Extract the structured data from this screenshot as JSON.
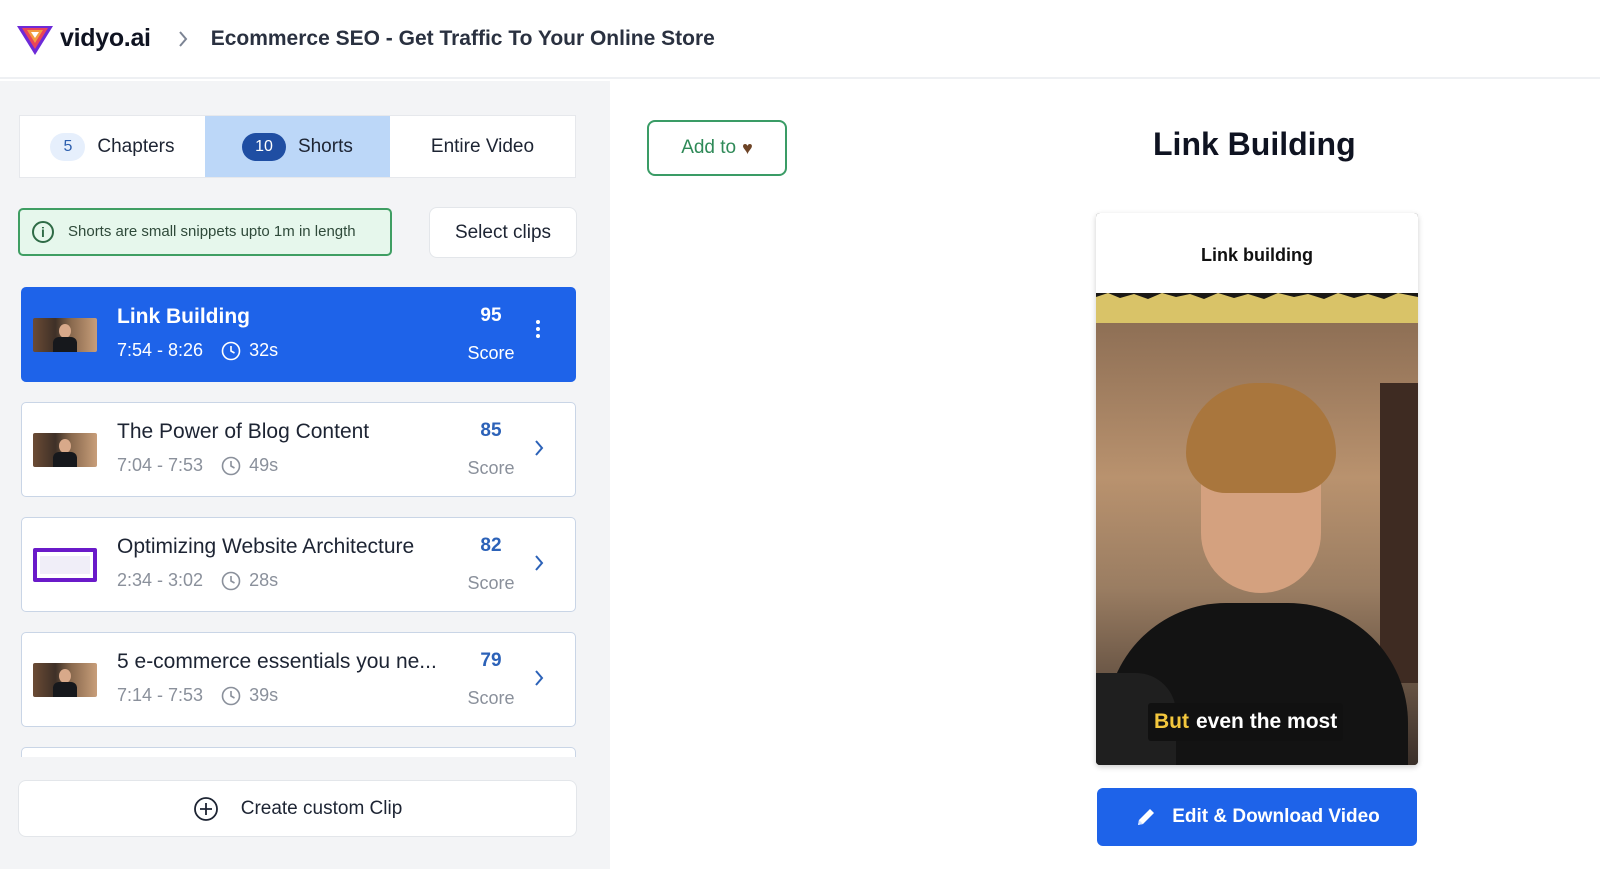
{
  "header": {
    "brand": "vidyo.ai",
    "breadcrumb_title": "Ecommerce SEO - Get Traffic To Your Online Store"
  },
  "tabs": [
    {
      "count": "5",
      "label": "Chapters",
      "active": false
    },
    {
      "count": "10",
      "label": "Shorts",
      "active": true
    },
    {
      "count": "",
      "label": "Entire Video",
      "active": false
    }
  ],
  "info": {
    "text": "Shorts are small snippets upto 1m in length"
  },
  "select_clips_label": "Select clips",
  "clips": [
    {
      "title": "Link Building",
      "range": "7:54 - 8:26",
      "duration": "32s",
      "score": "95",
      "score_label": "Score",
      "active": true
    },
    {
      "title": "The Power of Blog Content",
      "range": "7:04 - 7:53",
      "duration": "49s",
      "score": "85",
      "score_label": "Score",
      "active": false
    },
    {
      "title": "Optimizing Website Architecture",
      "range": "2:34 - 3:02",
      "duration": "28s",
      "score": "82",
      "score_label": "Score",
      "active": false
    },
    {
      "title": "5 e-commerce essentials you ne...",
      "range": "7:14 - 7:53",
      "duration": "39s",
      "score": "79",
      "score_label": "Score",
      "active": false
    }
  ],
  "create_custom_clip_label": "Create custom Clip",
  "preview": {
    "add_to_label": "Add to",
    "title": "Link Building",
    "video_title": "Link building",
    "caption_highlight": "But",
    "caption_rest": "even the most",
    "edit_download_label": "Edit & Download Video"
  },
  "colors": {
    "accent": "#1e63e9",
    "active_tab": "#bcd7f8",
    "info_bg": "#e6f7ec",
    "success": "#3a9c66"
  },
  "icons": {
    "logo": "vidyo-logo-icon",
    "breadcrumb_separator": "chevron-right-icon",
    "info": "info-icon",
    "clock": "clock-icon",
    "more": "kebab-icon",
    "chevron": "chevron-right-icon",
    "plus": "plus-circle-icon",
    "heart": "heart-icon",
    "pencil": "pencil-icon"
  }
}
